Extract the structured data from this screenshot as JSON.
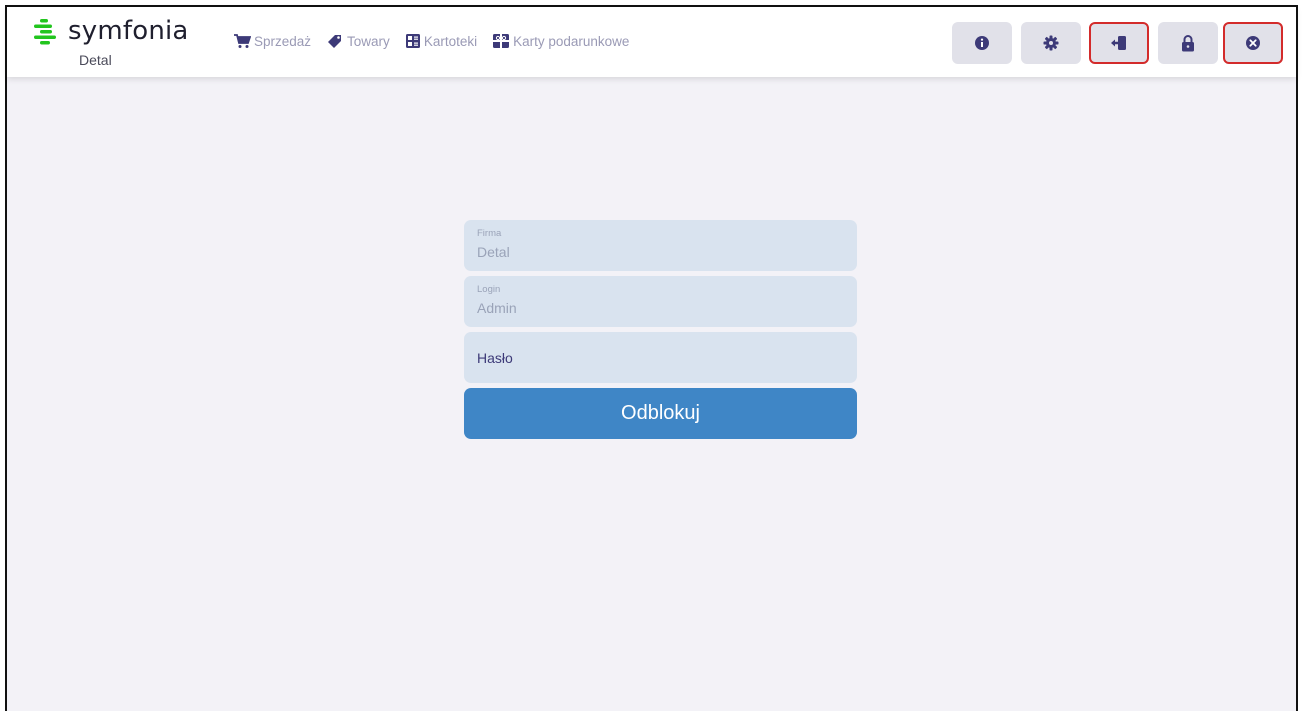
{
  "app": {
    "name": "symfonia",
    "subtitle": "Detal"
  },
  "nav": [
    {
      "label": "Sprzedaż",
      "icon": "cart-icon"
    },
    {
      "label": "Towary",
      "icon": "tag-icon"
    },
    {
      "label": "Kartoteki",
      "icon": "cards-icon"
    },
    {
      "label": "Karty podarunkowe",
      "icon": "gift-card-icon"
    }
  ],
  "toolbar": [
    {
      "icon": "info-icon",
      "highlighted": false
    },
    {
      "icon": "gear-icon",
      "highlighted": false
    },
    {
      "icon": "logout-icon",
      "highlighted": true
    },
    {
      "icon": "lock-icon",
      "highlighted": false
    },
    {
      "icon": "close-icon",
      "highlighted": true
    }
  ],
  "login": {
    "company_label": "Firma",
    "company_value": "Detal",
    "login_label": "Login",
    "login_value": "Admin",
    "password_placeholder": "Hasło",
    "unlock_label": "Odblokuj"
  },
  "colors": {
    "accent": "#3f86c6",
    "brand_green": "#22c51e",
    "highlight_outline": "#d32b2b",
    "icon_dark": "#3d3a78"
  }
}
